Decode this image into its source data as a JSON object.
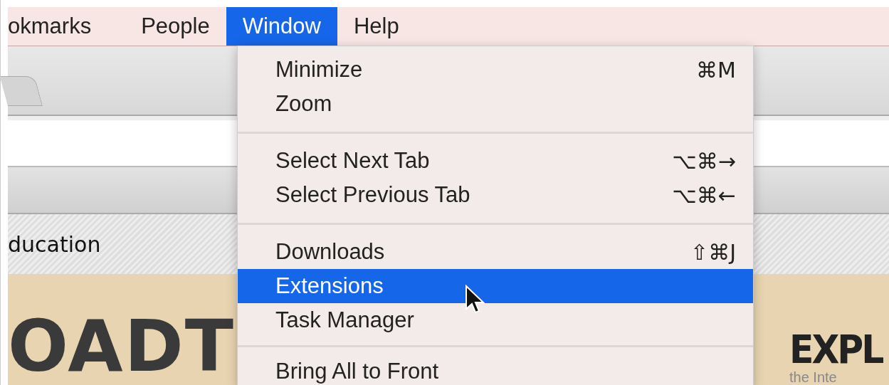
{
  "menu_bar": [
    {
      "label": "okmarks",
      "selected": false
    },
    {
      "label": "People",
      "selected": false
    },
    {
      "label": "Window",
      "selected": true
    },
    {
      "label": "Help",
      "selected": false
    }
  ],
  "menu": {
    "sections": [
      [
        {
          "label": "Minimize",
          "shortcut": "⌘M",
          "selected": false
        },
        {
          "label": "Zoom",
          "selected": false
        }
      ],
      [
        {
          "label": "Select Next Tab",
          "shortcut": "⌥⌘→",
          "selected": false
        },
        {
          "label": "Select Previous Tab",
          "shortcut": "⌥⌘←",
          "selected": false
        }
      ],
      [
        {
          "label": "Downloads",
          "shortcut": "⇧⌘J",
          "selected": false
        },
        {
          "label": "Extensions",
          "selected": true
        },
        {
          "label": "Task Manager",
          "selected": false
        }
      ],
      [
        {
          "label": "Bring All to Front",
          "selected": false
        }
      ]
    ]
  },
  "page": {
    "category": "ducation",
    "banner_left": "OADT",
    "banner_right": "EXPL",
    "banner_subtitle": "the Inte"
  }
}
